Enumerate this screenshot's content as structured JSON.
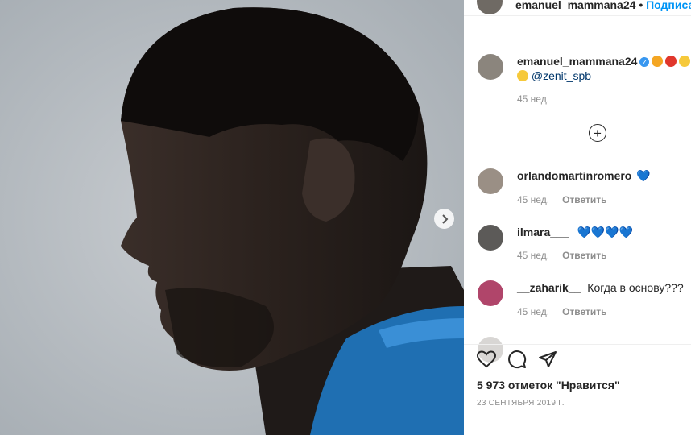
{
  "header": {
    "username": "emanuel_mammana24",
    "dot": "•",
    "follow_label": "Подписаться"
  },
  "caption": {
    "username": "emanuel_mammana24",
    "mention": "@zenit_spb",
    "time": "45 нед."
  },
  "comments": [
    {
      "username": "orlandomartinromero",
      "text": "💙",
      "time": "45 нед.",
      "reply": "Ответить"
    },
    {
      "username": "ilmara___",
      "text": "💙💙💙💙",
      "time": "45 нед.",
      "reply": "Ответить"
    },
    {
      "username": "__zaharik__",
      "text": "Когда в основу???",
      "time": "45 нед.",
      "reply": "Ответить"
    }
  ],
  "likes": {
    "text": "5 973 отметок \"Нравится\""
  },
  "post": {
    "date": "23 СЕНТЯБРЯ 2019 Г."
  },
  "icons": {
    "next": "chevron-right-icon",
    "load_more": "plus-circle-icon",
    "like": "heart-outline-icon",
    "comment": "comment-bubble-icon",
    "share": "paper-plane-icon"
  },
  "colors": {
    "link_blue": "#0095f6",
    "heart_blue": "#3897f0",
    "text": "#262626",
    "muted": "#8e8e8e"
  }
}
